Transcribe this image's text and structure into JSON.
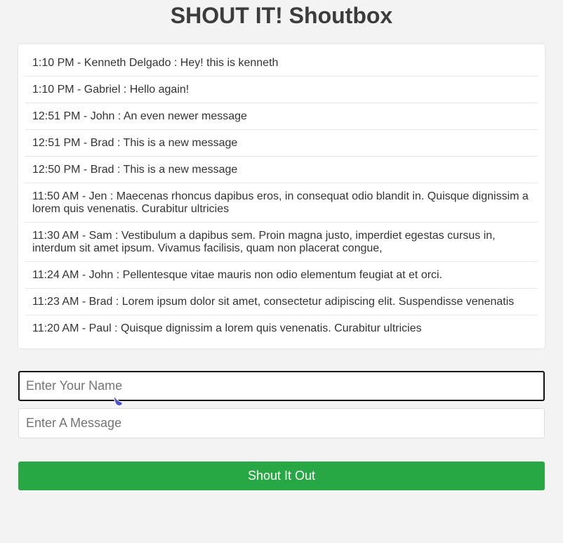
{
  "header": {
    "title": "SHOUT IT! Shoutbox"
  },
  "shouts": [
    {
      "text": "1:10 PM - Kenneth Delgado : Hey! this is kenneth"
    },
    {
      "text": "1:10 PM - Gabriel : Hello again!"
    },
    {
      "text": "12:51 PM - John : An even newer message"
    },
    {
      "text": "12:51 PM - Brad : This is a new message"
    },
    {
      "text": "12:50 PM - Brad : This is a new message"
    },
    {
      "text": "11:50 AM - Jen : Maecenas rhoncus dapibus eros, in consequat odio blandit in. Quisque dignissim a lorem quis venenatis. Curabitur ultricies"
    },
    {
      "text": "11:30 AM - Sam : Vestibulum a dapibus sem. Proin magna justo, imperdiet egestas cursus in, interdum sit amet ipsum. Vivamus facilisis, quam non placerat congue,"
    },
    {
      "text": "11:24 AM - John : Pellentesque vitae mauris non odio elementum feugiat at et orci."
    },
    {
      "text": "11:23 AM - Brad : Lorem ipsum dolor sit amet, consectetur adipiscing elit. Suspendisse venenatis"
    },
    {
      "text": "11:20 AM - Paul : Quisque dignissim a lorem quis venenatis. Curabitur ultricies"
    }
  ],
  "form": {
    "name": {
      "placeholder": "Enter Your Name",
      "value": ""
    },
    "message": {
      "placeholder": "Enter A Message",
      "value": ""
    },
    "submit_label": "Shout It Out"
  },
  "colors": {
    "submit_button": "#28a745",
    "cursor": "#4b4fd8"
  },
  "icons": {
    "cursor": "pointer-cursor-icon"
  }
}
